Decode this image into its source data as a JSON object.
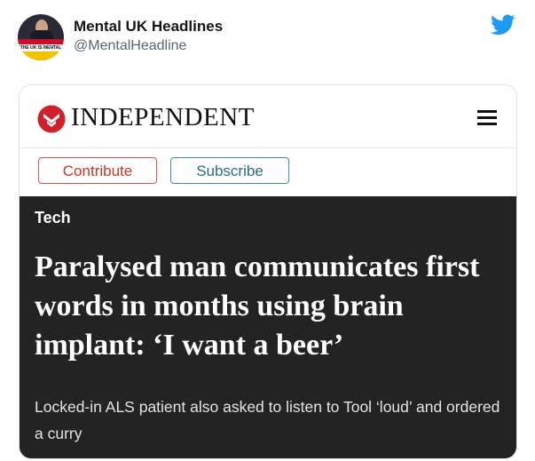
{
  "tweet": {
    "display_name": "Mental UK Headlines",
    "handle": "@MentalHeadline",
    "avatar_text": "THE UK IS MENTAL",
    "bird_icon": "twitter-bird-icon",
    "bird_color": "#1d9bf0"
  },
  "article": {
    "publication": "INDEPENDENT",
    "logo_icon": "independent-eagle-icon",
    "brand_color": "#d0202e",
    "menu_icon": "hamburger-menu-icon",
    "buttons": {
      "contribute": "Contribute",
      "subscribe": "Subscribe"
    },
    "section": "Tech",
    "headline": "Paralysed man communicates first words in months using brain implant: ‘I want a beer’",
    "standfirst": "Locked-in ALS patient also asked to listen to Tool ‘loud’ and ordered a curry"
  }
}
